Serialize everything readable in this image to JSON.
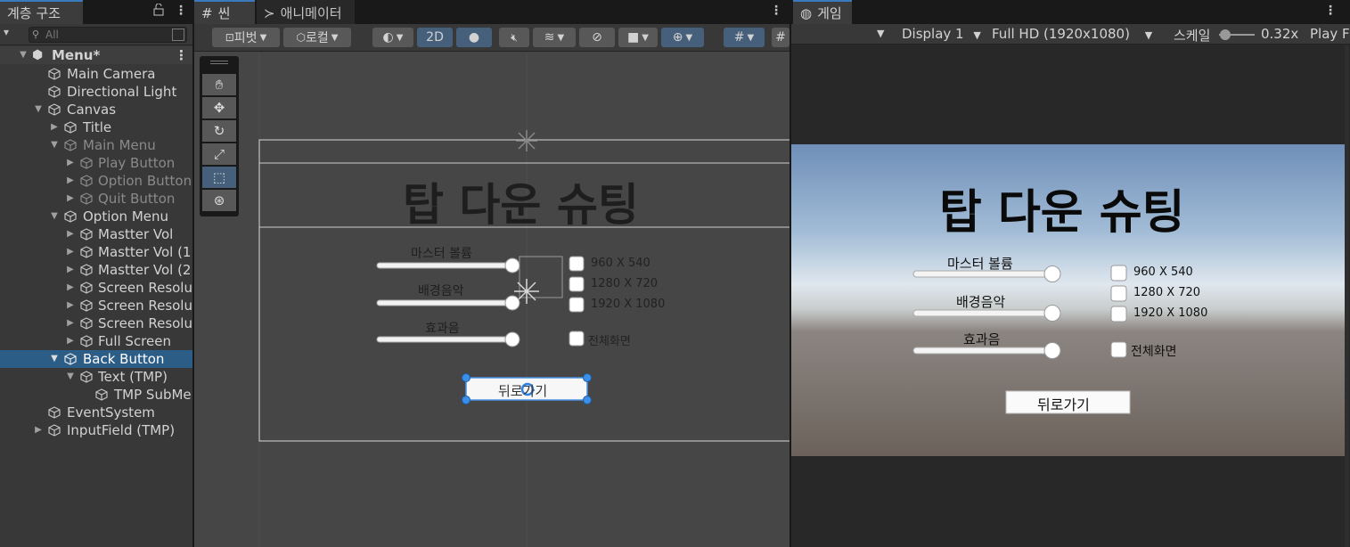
{
  "hierarchy": {
    "tab_label": "계층 구조",
    "search_placeholder": "All",
    "rows": [
      {
        "label": "Menu*"
      },
      {
        "label": "Main Camera"
      },
      {
        "label": "Directional Light"
      },
      {
        "label": "Canvas"
      },
      {
        "label": "Title"
      },
      {
        "label": "Main Menu"
      },
      {
        "label": "Play Button"
      },
      {
        "label": "Option Button"
      },
      {
        "label": "Quit Button"
      },
      {
        "label": "Option Menu"
      },
      {
        "label": "Mastter Vol"
      },
      {
        "label": "Mastter Vol (1"
      },
      {
        "label": "Mastter Vol (2"
      },
      {
        "label": "Screen Resolu"
      },
      {
        "label": "Screen Resolu"
      },
      {
        "label": "Screen Resolu"
      },
      {
        "label": "Full Screen"
      },
      {
        "label": "Back Button"
      },
      {
        "label": "Text (TMP)"
      },
      {
        "label": "TMP SubMe"
      },
      {
        "label": "EventSystem"
      },
      {
        "label": "InputField (TMP)"
      }
    ]
  },
  "scene": {
    "tab_label": "씬",
    "animator_tab_label": "애니메이터",
    "pivot_label": "피벗",
    "local_label": "로컬",
    "mode_2d": "2D"
  },
  "game": {
    "tab_label": "게임",
    "display": "Display 1",
    "resolution": "Full HD (1920x1080)",
    "scale_label": "스케일",
    "scale_value": "0.32x",
    "play_label": "Play F"
  },
  "ui": {
    "title": "탑 다운 슈팅",
    "master_volume": "마스터 볼륨",
    "bgm": "배경음악",
    "sfx": "효과음",
    "res1": "960 X 540",
    "res2": "1280 X 720",
    "res3": "1920 X 1080",
    "fullscreen": "전체화면",
    "back": "뒤로가기"
  }
}
